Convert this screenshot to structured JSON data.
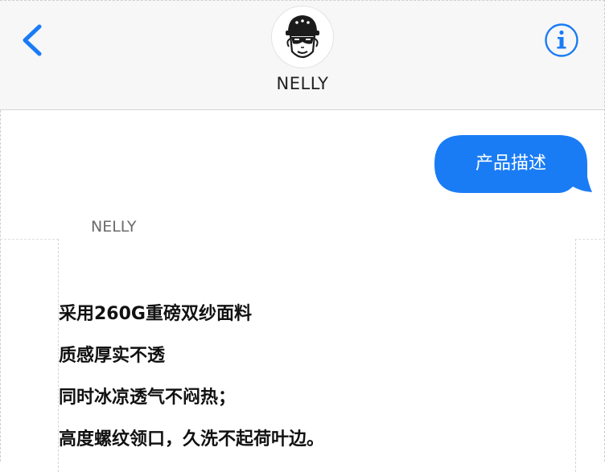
{
  "header": {
    "contact_name": "NELLY",
    "back_icon": "chevron-left-icon",
    "info_icon": "info-circle-icon",
    "avatar_icon": "cartoon-face-avatar"
  },
  "colors": {
    "accent": "#1a7cf5",
    "header_bg": "#f7f7f7",
    "bubble_text": "#ffffff"
  },
  "messages": {
    "outgoing": {
      "text": "产品描述"
    },
    "incoming": {
      "sender": "NELLY",
      "lines": [
        "采用260G重磅双纱面料",
        "质感厚实不透",
        "同时冰凉透气不闷热；",
        "高度螺纹领口，久洗不起荷叶边。"
      ]
    }
  }
}
